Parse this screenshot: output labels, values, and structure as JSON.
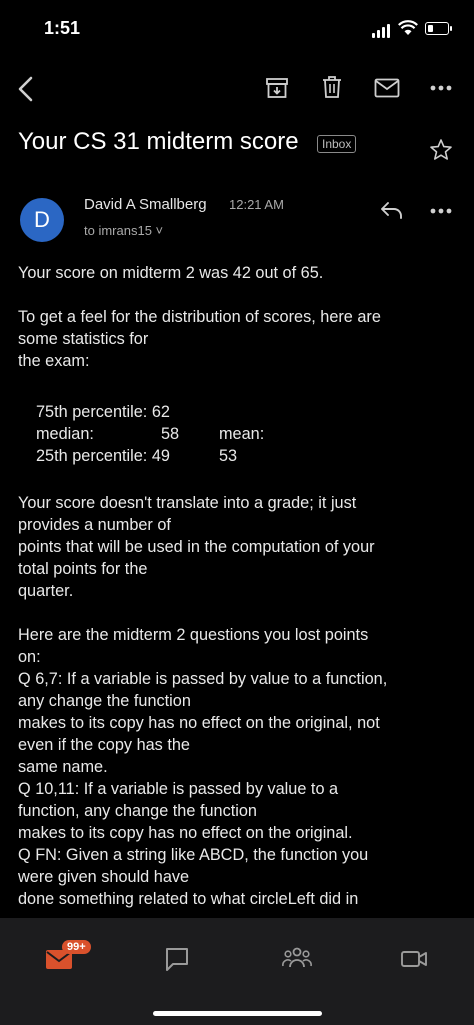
{
  "status": {
    "time": "1:51"
  },
  "toolbar": {
    "icons": [
      "back-icon",
      "archive-icon",
      "trash-icon",
      "mail-icon",
      "more-icon"
    ]
  },
  "email": {
    "subject": "Your CS 31 midterm score",
    "label": "Inbox",
    "avatar_letter": "D",
    "sender": "David A Smallberg",
    "time": "12:21 AM",
    "to": "to imrans15 ˅",
    "p1": "Your score on midterm 2 was 42 out of 65.",
    "p2": "To get a feel for the distribution of scores, here are\nsome statistics for\nthe exam:",
    "stats": {
      "p75": "75th percentile: 62",
      "median_label": "median:",
      "median_value": "58",
      "mean": "mean: 53",
      "p25": "25th percentile: 49"
    },
    "p3": "Your score doesn't translate into a grade; it just\nprovides a number of\npoints that will be used in the computation of your\ntotal points for the\nquarter.",
    "p4": "Here are the midterm 2 questions you lost points\non:\nQ 6,7: If a variable is passed by value to a function,\nany change the function\nmakes to its copy has no effect on the original, not\neven if the copy has the\nsame name.\nQ 10,11: If a variable is passed by value to a\nfunction, any change the function\nmakes to its copy has no effect on the original.\nQ FN: Given a string like ABCD, the function you\nwere given should have\ndone something related to what circleLeft did in"
  },
  "bottom_nav": {
    "mail_badge": "99+"
  }
}
